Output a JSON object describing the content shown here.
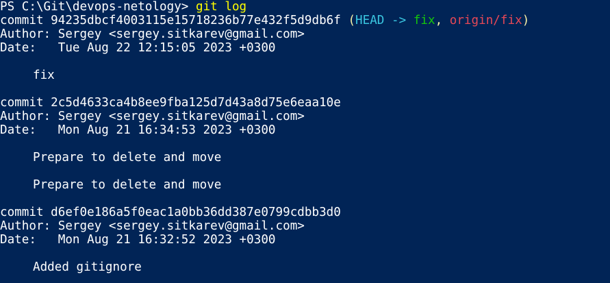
{
  "prompt": {
    "text": "PS C:\\Git\\devops-netology> ",
    "command": "git log"
  },
  "commits": [
    {
      "hash_line": "commit 94235dbcf4003115e15718236b77e432f5d9db6f ",
      "refs": {
        "open": "(",
        "head": "HEAD -> ",
        "branch": "fix",
        "sep": ", ",
        "remote": "origin/fix",
        "close": ")"
      },
      "author": "Author: Sergey <sergey.sitkarev@gmail.com>",
      "date": "Date:   Tue Aug 22 12:15:05 2023 +0300",
      "messages": [
        "fix"
      ]
    },
    {
      "hash_line": "commit 2c5d4633ca4b8ee9fba125d7d43a8d75e6eaa10e",
      "author": "Author: Sergey <sergey.sitkarev@gmail.com>",
      "date": "Date:   Mon Aug 21 16:34:53 2023 +0300",
      "messages": [
        "Prepare to delete and move",
        "Prepare to delete and move"
      ]
    },
    {
      "hash_line": "commit d6ef0e186a5f0eac1a0bb36dd387e0799cdbb3d0",
      "author": "Author: Sergey <sergey.sitkarev@gmail.com>",
      "date": "Date:   Mon Aug 21 16:32:52 2023 +0300",
      "messages": [
        "Added gitignore"
      ]
    }
  ],
  "colors": {
    "background": "#012456",
    "foreground": "#ffffff",
    "command": "#ffff00",
    "head": "#3ac6e0",
    "branch": "#16c60c",
    "remote": "#e74856",
    "paren": "#f9f1a5"
  }
}
